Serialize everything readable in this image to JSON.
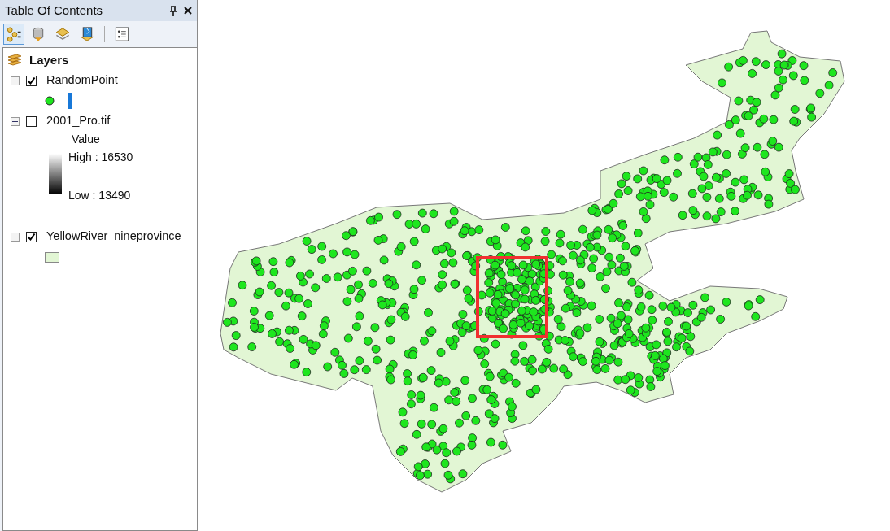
{
  "panel": {
    "title": "Table Of Contents"
  },
  "toolbar": [
    {
      "selected": true
    },
    {
      "selected": false
    },
    {
      "selected": false
    },
    {
      "selected": false
    },
    {
      "selected": false
    }
  ],
  "tree": {
    "label": "Layers",
    "layers": [
      {
        "name": "RandomPoint",
        "checked": true,
        "expanded": true,
        "legend": {
          "kind": "point"
        }
      },
      {
        "name": "2001_Pro.tif",
        "checked": false,
        "expanded": true,
        "legend": {
          "kind": "ramp",
          "heading": "Value",
          "high": "High : 16530",
          "low": "Low : 13490"
        }
      },
      {
        "name": "YellowRiver_nineprovince",
        "checked": true,
        "expanded": true,
        "legend": {
          "kind": "fill"
        }
      }
    ]
  }
}
